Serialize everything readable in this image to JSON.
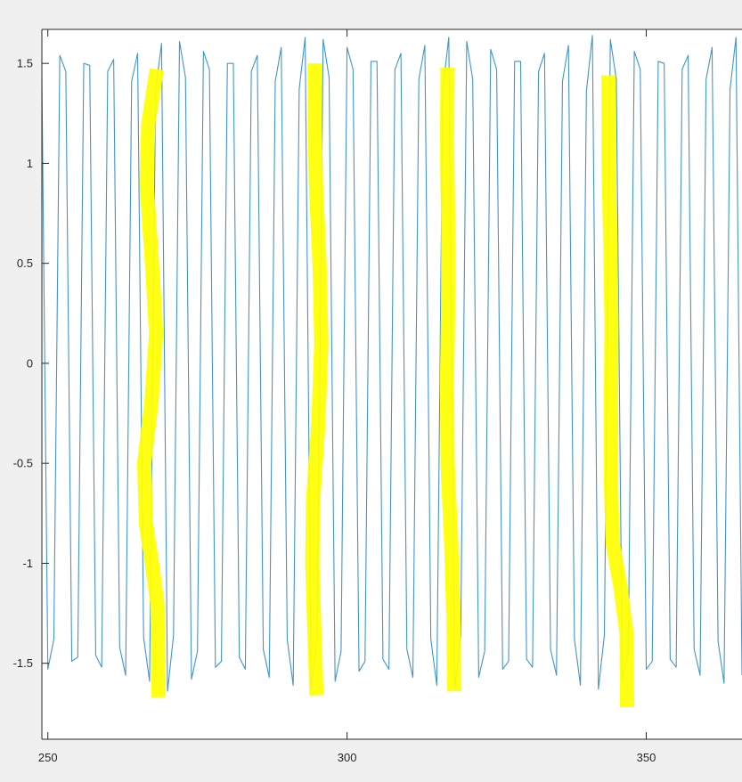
{
  "colors": {
    "figure_background": "#f0f0f0",
    "axes_background": "#ffffff",
    "axes_frame": "#262626",
    "series_line": "#0072bd",
    "highlight_stroke": "#ffff00"
  },
  "chart_data": {
    "type": "line",
    "title": "",
    "xlabel": "",
    "ylabel": "",
    "xlim": [
      249,
      366
    ],
    "ylim": [
      -1.88,
      1.67
    ],
    "grid": false,
    "legend": "none",
    "x_ticks": [
      250,
      300,
      350
    ],
    "x_tick_labels": [
      "250",
      "300",
      "350"
    ],
    "y_ticks": [
      1.5,
      1,
      0.5,
      0,
      -0.5,
      -1,
      -1.5
    ],
    "y_tick_labels": [
      "1.5",
      "1",
      "0.5",
      "0",
      "-0.5",
      "-1",
      "-1.5"
    ],
    "series": [
      {
        "x": [
          249,
          250,
          251,
          252,
          253,
          254,
          255,
          256,
          257,
          258,
          259,
          260,
          261,
          262,
          263,
          264,
          265,
          266,
          267,
          268,
          269,
          270,
          271,
          272,
          273,
          274,
          275,
          276,
          277,
          278,
          279,
          280,
          281,
          282,
          283,
          284,
          285,
          286,
          287,
          288,
          289,
          290,
          291,
          292,
          293,
          294,
          295,
          296,
          297,
          298,
          299,
          300,
          301,
          302,
          303,
          304,
          305,
          306,
          307,
          308,
          309,
          310,
          311,
          312,
          313,
          314,
          315,
          316,
          317,
          318,
          319,
          320,
          321,
          322,
          323,
          324,
          325,
          326,
          327,
          328,
          329,
          330,
          331,
          332,
          333,
          334,
          335,
          336,
          337,
          338,
          339,
          340,
          341,
          342,
          343,
          344,
          345,
          346,
          347,
          348,
          349,
          350,
          351,
          352,
          353,
          354,
          355,
          356,
          357,
          358,
          359,
          360,
          361,
          362,
          363,
          364,
          365,
          366
        ],
        "y": [
          1.43,
          -1.53,
          -1.38,
          1.54,
          1.46,
          -1.49,
          -1.47,
          1.5,
          1.49,
          -1.46,
          -1.52,
          1.46,
          1.52,
          -1.42,
          -1.56,
          1.41,
          1.55,
          -1.37,
          -1.59,
          1.36,
          1.6,
          -1.64,
          -1.36,
          1.61,
          1.43,
          -1.58,
          -1.44,
          1.56,
          1.47,
          -1.52,
          -1.49,
          1.5,
          1.5,
          -1.47,
          -1.53,
          1.46,
          1.54,
          -1.43,
          -1.57,
          1.41,
          1.58,
          -1.38,
          -1.61,
          1.37,
          1.63,
          -1.63,
          -1.36,
          1.62,
          1.43,
          -1.59,
          -1.44,
          1.58,
          1.47,
          -1.54,
          -1.49,
          1.51,
          1.51,
          -1.48,
          -1.53,
          1.47,
          1.55,
          -1.43,
          -1.57,
          1.42,
          1.59,
          -1.38,
          -1.61,
          1.37,
          1.63,
          -1.63,
          -1.36,
          1.61,
          1.42,
          -1.57,
          -1.44,
          1.57,
          1.47,
          -1.53,
          -1.49,
          1.51,
          1.51,
          -1.48,
          -1.52,
          1.46,
          1.55,
          -1.43,
          -1.56,
          1.41,
          1.59,
          -1.38,
          -1.61,
          1.36,
          1.64,
          -1.63,
          -1.36,
          1.62,
          1.42,
          -1.58,
          -1.44,
          1.56,
          1.47,
          -1.53,
          -1.49,
          1.51,
          1.5,
          -1.48,
          -1.52,
          1.47,
          1.54,
          -1.43,
          -1.56,
          1.42,
          1.58,
          -1.39,
          -1.6,
          1.37,
          1.63,
          -1.56
        ]
      }
    ],
    "annotations": [
      {
        "type": "highlight-stroke",
        "points": [
          [
            268.2,
            1.47
          ],
          [
            266.8,
            1.2
          ],
          [
            266.5,
            0.9
          ],
          [
            267.4,
            0.5
          ],
          [
            268.1,
            0.15
          ],
          [
            267.3,
            -0.2
          ],
          [
            266.1,
            -0.5
          ],
          [
            266.4,
            -0.8
          ],
          [
            267.4,
            -1.0
          ],
          [
            268.3,
            -1.2
          ],
          [
            268.4,
            -1.45
          ],
          [
            268.5,
            -1.67
          ]
        ]
      },
      {
        "type": "highlight-stroke",
        "points": [
          [
            294.6,
            1.5
          ],
          [
            294.6,
            1.2
          ],
          [
            294.8,
            0.9
          ],
          [
            295.4,
            0.5
          ],
          [
            295.7,
            0.1
          ],
          [
            295.2,
            -0.3
          ],
          [
            294.3,
            -0.7
          ],
          [
            294.2,
            -1.0
          ],
          [
            294.5,
            -1.3
          ],
          [
            294.9,
            -1.66
          ]
        ]
      },
      {
        "type": "highlight-stroke",
        "points": [
          [
            316.8,
            1.48
          ],
          [
            316.7,
            1.1
          ],
          [
            316.9,
            0.7
          ],
          [
            316.9,
            0.3
          ],
          [
            316.7,
            -0.1
          ],
          [
            316.8,
            -0.5
          ],
          [
            317.4,
            -0.9
          ],
          [
            317.8,
            -1.3
          ],
          [
            317.9,
            -1.64
          ]
        ]
      },
      {
        "type": "highlight-stroke",
        "points": [
          [
            343.7,
            1.44
          ],
          [
            343.7,
            1.0
          ],
          [
            344.0,
            0.6
          ],
          [
            344.2,
            0.2
          ],
          [
            344.1,
            -0.2
          ],
          [
            344.1,
            -0.6
          ],
          [
            344.4,
            -0.9
          ],
          [
            345.7,
            -1.12
          ],
          [
            346.7,
            -1.35
          ],
          [
            346.8,
            -1.72
          ]
        ]
      }
    ]
  }
}
